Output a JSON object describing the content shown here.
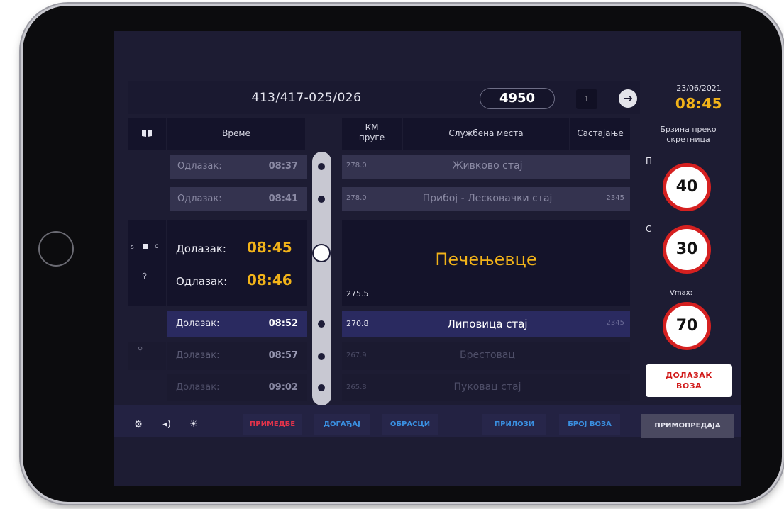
{
  "header": {
    "train_id": "413/417-025/026",
    "train_number": "4950",
    "page": "1",
    "date": "23/06/2021",
    "time": "08:45"
  },
  "columns": {
    "time": "Време",
    "km_line1": "КМ",
    "km_line2": "пруге",
    "stations": "Службена места",
    "meeting": "Састајање",
    "speed_line1": "Брзина преко",
    "speed_line2": "скретница"
  },
  "rows": [
    {
      "label": "Одлазак:",
      "time": "08:37",
      "km": "278.0",
      "station": "Живково стај",
      "meeting": ""
    },
    {
      "label": "Одлазак:",
      "time": "08:41",
      "km": "278.0",
      "station": "Прибој - Лесковачки стај",
      "meeting": "2345"
    },
    {
      "label": "Долазак:",
      "time": "08:52",
      "km": "270.8",
      "station": "Липовица стај",
      "meeting": "2345"
    },
    {
      "label": "Долазак:",
      "time": "08:57",
      "km": "267.9",
      "station": "Брестовац",
      "meeting": ""
    },
    {
      "label": "Долазак:",
      "time": "09:02",
      "km": "265.8",
      "station": "Пуковац стај",
      "meeting": ""
    }
  ],
  "current": {
    "arrival_label": "Долазак:",
    "arrival_time": "08:45",
    "departure_label": "Одлазак:",
    "departure_time": "08:46",
    "km": "275.5",
    "station": "Печењевце",
    "signal_left": "s",
    "signal_right": "c"
  },
  "speeds": {
    "p_label": "П",
    "p_value": "40",
    "c_label": "С",
    "c_value": "30",
    "vmax_label": "Vmax:",
    "vmax_value": "70"
  },
  "arrival_button": {
    "line1": "ДОЛАЗАК",
    "line2": "ВОЗА"
  },
  "bottom": {
    "remarks": "ПРИМЕДБЕ",
    "event": "ДОГАЂАЈ",
    "forms": "ОБРАСЦИ",
    "attachments": "ПРИЛОЗИ",
    "train_number": "БРОЈ ВОЗА",
    "handover": "ПРИМОПРЕДАЈА"
  },
  "colors": {
    "accent_yellow": "#f2b319",
    "signal_red": "#d52020",
    "link_blue": "#3a8fe0",
    "remarks_red": "#e2334a"
  }
}
